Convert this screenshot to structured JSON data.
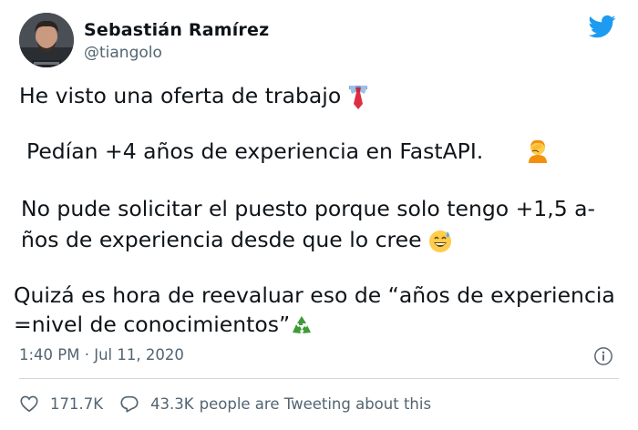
{
  "author": {
    "name": "Sebastián Ramírez",
    "handle": "@tiangolo",
    "avatar_icon": "user-avatar-photo"
  },
  "brand": {
    "icon": "twitter-bird-icon",
    "color": "#1d9bf0"
  },
  "tweet": {
    "line1": "He visto una oferta de trabajo ",
    "line2": "Pedían +4 años de experiencia en FastAPI.",
    "line3": "No pude solicitar el puesto porque solo tengo +1,5 a-",
    "line4": "ños de experiencia desde que lo cree ",
    "line5": "Quizá es hora de reevaluar eso de “años de experiencia",
    "line6": "=nivel de conocimientos”",
    "emojis": [
      "necktie-emoji",
      "person-facepalming-emoji",
      "grinning-sweat-emoji",
      "recycling-emoji"
    ]
  },
  "meta": {
    "timestamp": "1:40 PM · Jul 11, 2020",
    "info_icon": "info-icon"
  },
  "actions": {
    "likes": "171.7K",
    "tweeting_count": "43.3K",
    "tweeting_text": "people are Tweeting about this"
  },
  "colors": {
    "text": "#0f1419",
    "secondary": "#536471",
    "divider": "#cfd9de"
  }
}
